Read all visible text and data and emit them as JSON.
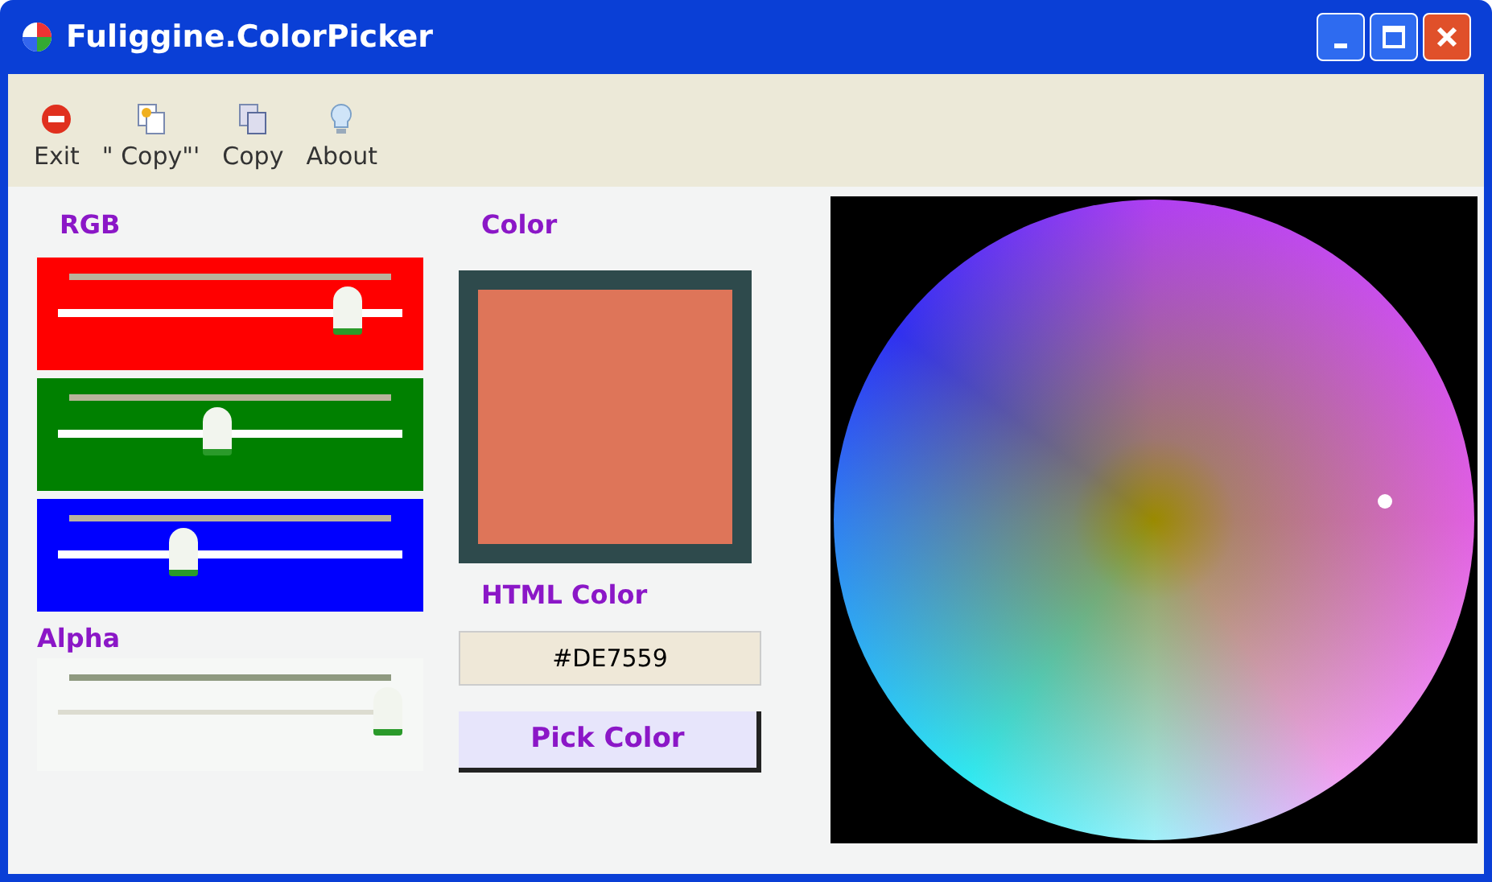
{
  "window": {
    "title": "Fuliggine.ColorPicker"
  },
  "toolbar": [
    {
      "label": "Exit",
      "kind": "exit"
    },
    {
      "label": "\" Copy\"'",
      "kind": "copy-quoted"
    },
    {
      "label": "Copy",
      "kind": "copy"
    },
    {
      "label": "About",
      "kind": "about"
    }
  ],
  "rgb": {
    "label": "RGB",
    "channels": [
      {
        "color": "#ff0000",
        "level": 0.87
      },
      {
        "color": "#008000",
        "level": 0.46
      },
      {
        "color": "#0000ff",
        "level": 0.35
      }
    ]
  },
  "alpha": {
    "label": "Alpha",
    "level": 1.0
  },
  "color": {
    "label": "Color"
  },
  "html_color": {
    "label": "HTML Color",
    "value": "#DE7559"
  },
  "pick_button": "Pick Color"
}
